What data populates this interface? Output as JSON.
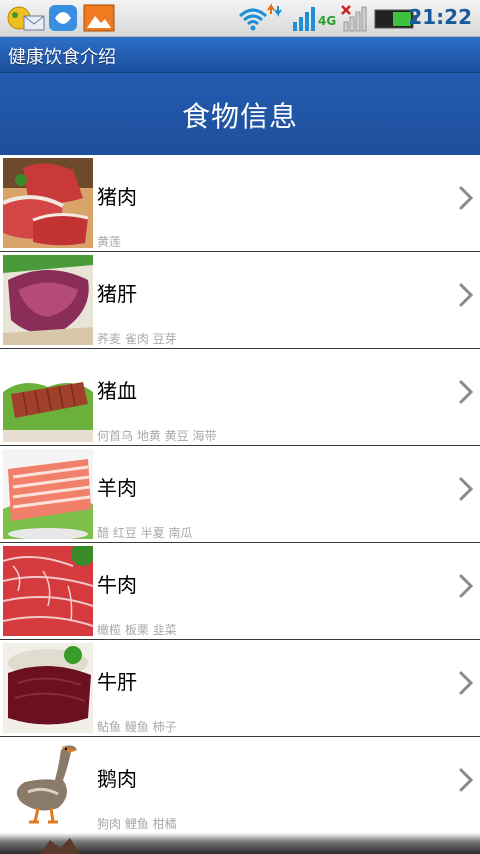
{
  "status_bar": {
    "time": "21:22",
    "network": "4G",
    "icons": [
      "sms-icon",
      "qq-icon",
      "gallery-icon",
      "wifi-icon",
      "signal-icon",
      "no-signal-icon",
      "battery-icon"
    ]
  },
  "app": {
    "title": "健康饮食介绍"
  },
  "header": {
    "title": "食物信息"
  },
  "foods": [
    {
      "name": "猪肉",
      "pairs": "黄莲",
      "image": "pork-image"
    },
    {
      "name": "猪肝",
      "pairs": "荞麦 雀肉 豆芽",
      "image": "pork-liver-image"
    },
    {
      "name": "猪血",
      "pairs": "何首乌 地黄 黄豆 海带",
      "image": "pork-blood-image"
    },
    {
      "name": "羊肉",
      "pairs": "醋 红豆 半夏 南瓜",
      "image": "mutton-image"
    },
    {
      "name": "牛肉",
      "pairs": "橄榄 板栗 韭菜",
      "image": "beef-image"
    },
    {
      "name": "牛肝",
      "pairs": "鲇鱼 鳗鱼 柿子",
      "image": "beef-liver-image"
    },
    {
      "name": "鹅肉",
      "pairs": "狗肉 鲤鱼 柑橘",
      "image": "goose-image"
    }
  ],
  "colors": {
    "title_bar": "#1b4f9e",
    "header": "#245cb0",
    "time_text": "#1a5a9c",
    "sub_text": "#a9a9a9"
  }
}
